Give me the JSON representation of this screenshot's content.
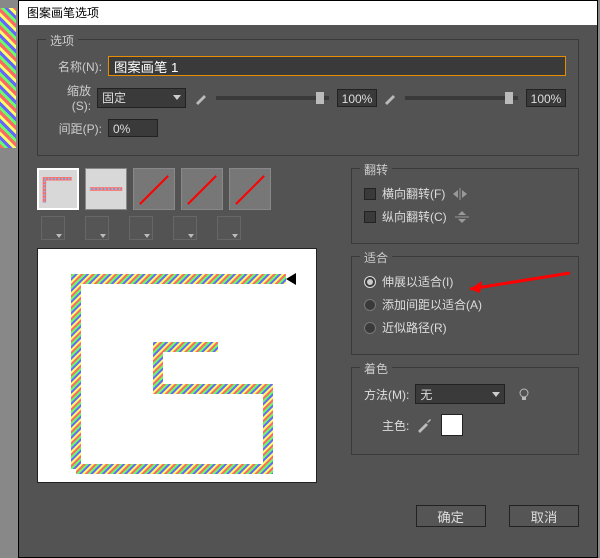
{
  "window_title": "图案画笔选项",
  "section_options": "选项",
  "name_label": "名称(N):",
  "name_value": "图案画笔 1",
  "scale_label": "缩放(S):",
  "scale_mode": "固定",
  "scale_value1": "100%",
  "scale_value2": "100%",
  "spacing_label": "间距(P):",
  "spacing_value": "0%",
  "flip": {
    "legend": "翻转",
    "h": "横向翻转(F)",
    "v": "纵向翻转(C)"
  },
  "fit": {
    "legend": "适合",
    "stretch": "伸展以适合(I)",
    "space": "添加间距以适合(A)",
    "approx": "近似路径(R)"
  },
  "color": {
    "legend": "着色",
    "method_label": "方法(M):",
    "method_value": "无",
    "main_label": "主色:"
  },
  "buttons": {
    "ok": "确定",
    "cancel": "取消"
  }
}
